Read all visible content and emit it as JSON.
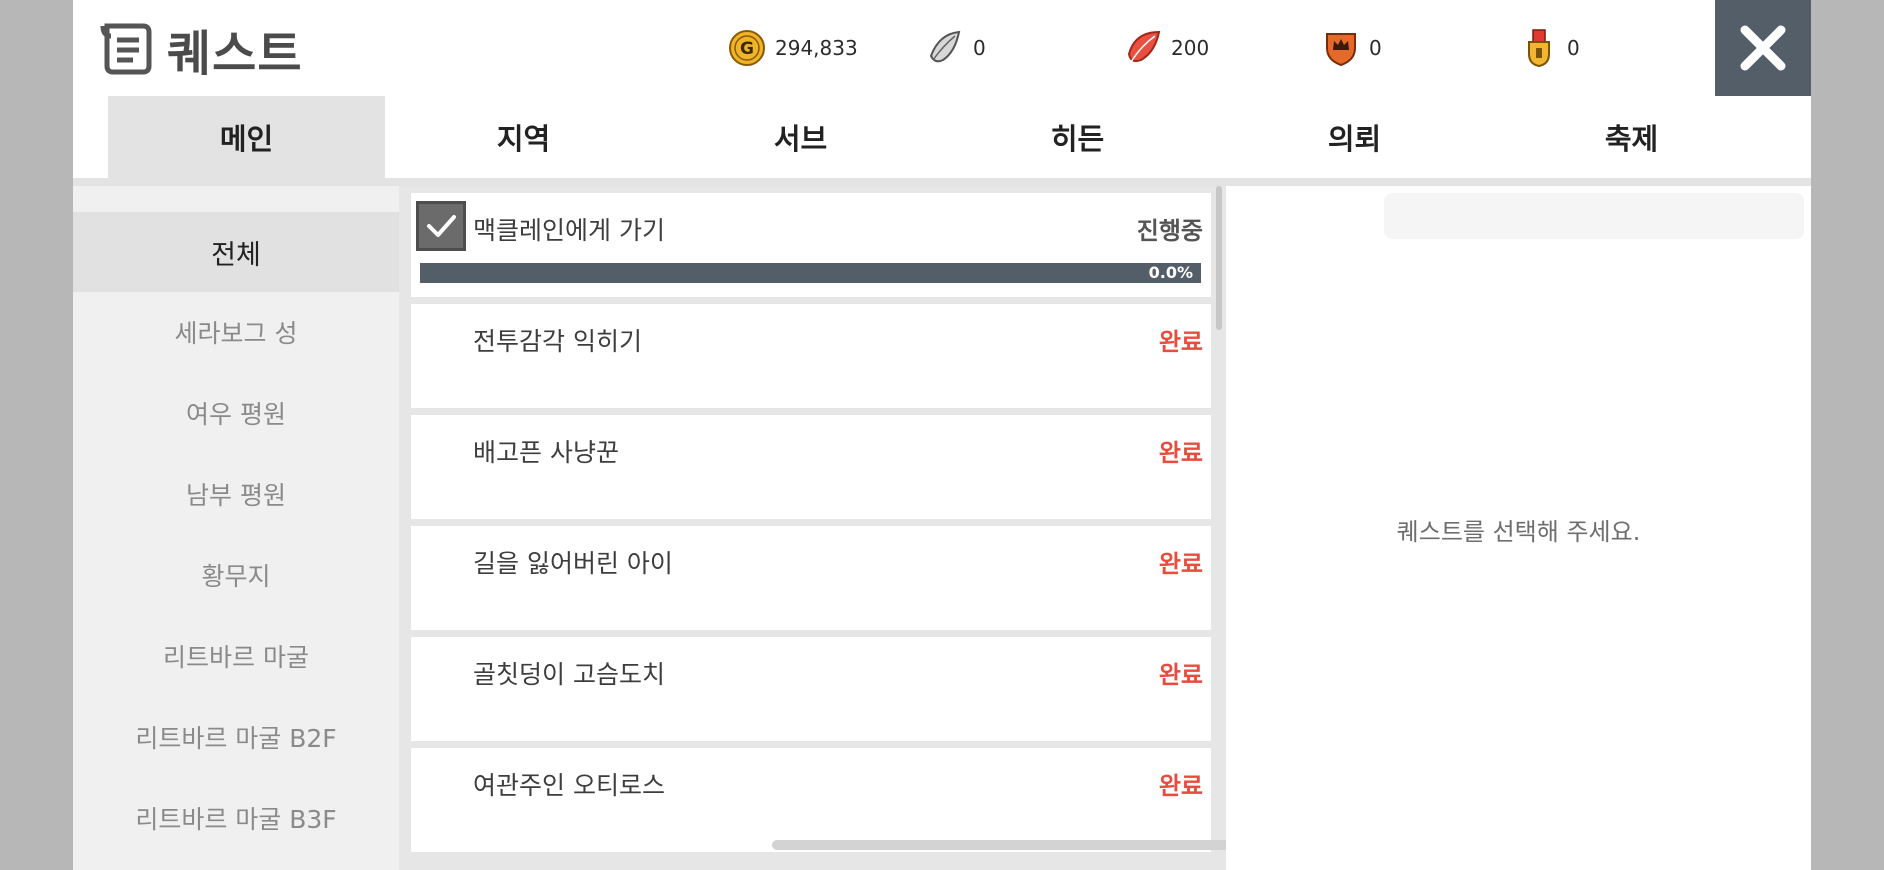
{
  "title": "퀘스트",
  "currencies": [
    {
      "name": "gold-coin-icon",
      "value": "294,833"
    },
    {
      "name": "silver-feather-icon",
      "value": "0"
    },
    {
      "name": "red-feather-icon",
      "value": "200"
    },
    {
      "name": "crown-shield-icon",
      "value": "0"
    },
    {
      "name": "medal-icon",
      "value": "0"
    }
  ],
  "tabs": [
    {
      "label": "메인",
      "active": true
    },
    {
      "label": "지역",
      "active": false
    },
    {
      "label": "서브",
      "active": false
    },
    {
      "label": "히든",
      "active": false
    },
    {
      "label": "의뢰",
      "active": false
    },
    {
      "label": "축제",
      "active": false
    }
  ],
  "sidebar": [
    {
      "label": "전체",
      "active": true
    },
    {
      "label": "세라보그 성",
      "active": false
    },
    {
      "label": "여우 평원",
      "active": false
    },
    {
      "label": "남부 평원",
      "active": false
    },
    {
      "label": "황무지",
      "active": false
    },
    {
      "label": "리트바르 마굴",
      "active": false
    },
    {
      "label": "리트바르 마굴 B2F",
      "active": false
    },
    {
      "label": "리트바르 마굴 B3F",
      "active": false
    }
  ],
  "quests": [
    {
      "name": "맥클레인에게 가기",
      "status": "진행중",
      "in_progress": true,
      "progress_label": "0.0%",
      "progress": 0.0
    },
    {
      "name": "전투감각 익히기",
      "status": "완료",
      "in_progress": false
    },
    {
      "name": "배고픈 사냥꾼",
      "status": "완료",
      "in_progress": false
    },
    {
      "name": "길을 잃어버린 아이",
      "status": "완료",
      "in_progress": false
    },
    {
      "name": "골칫덩이 고슴도치",
      "status": "완료",
      "in_progress": false
    },
    {
      "name": "여관주인 오티로스",
      "status": "완료",
      "in_progress": false
    }
  ],
  "detail": {
    "placeholder": "퀘스트를 선택해 주세요."
  },
  "colors": {
    "close_bg": "#545e68",
    "done": "#e84c3d",
    "progress_bar": "#545e68"
  }
}
